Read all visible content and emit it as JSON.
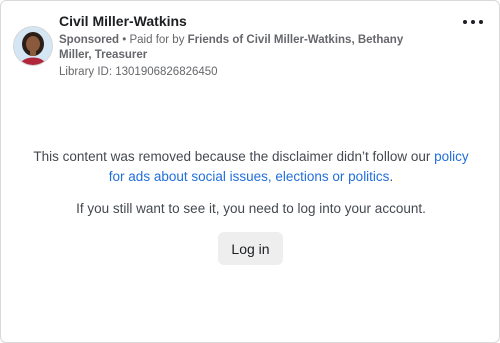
{
  "ad": {
    "page_name": "Civil Miller-Watkins",
    "sponsored_label": "Sponsored",
    "separator": " • ",
    "paid_for_prefix": "Paid for by ",
    "paid_for_by": "Friends of Civil Miller-Watkins, Bethany Miller, Treasurer",
    "library_id": "Library ID: 1301906826826450",
    "menu_icon": "more-options-icon"
  },
  "notice": {
    "removed_text": "This content was removed because the disclaimer didn’t follow our ",
    "policy_link": "policy for ads about social issues, elections or politics",
    "removed_suffix": ".",
    "login_prompt": "If you still want to see it, you need to log into your account.",
    "login_button": "Log in"
  },
  "colors": {
    "link": "#216fdb",
    "secondary_text": "#65676b",
    "button_bg": "#eeeeee"
  }
}
